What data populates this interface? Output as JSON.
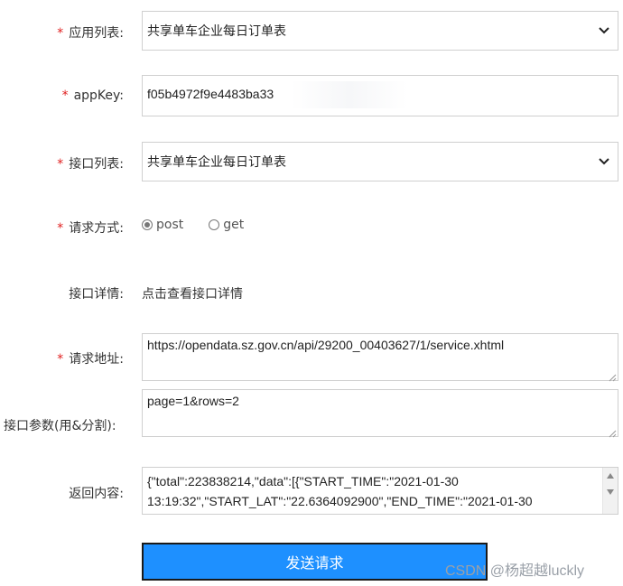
{
  "form": {
    "app_list": {
      "label": "应用列表:",
      "value": "共享单车企业每日订单表",
      "required": true
    },
    "app_key": {
      "label": "appKey:",
      "value": "f05b4972f9e4483ba33",
      "required": true
    },
    "api_list": {
      "label": "接口列表:",
      "value": "共享单车企业每日订单表",
      "required": true
    },
    "method": {
      "label": "请求方式:",
      "required": true,
      "options": [
        "post",
        "get"
      ],
      "selected": "post"
    },
    "api_detail": {
      "label": "接口详情:",
      "link": "点击查看接口详情"
    },
    "url": {
      "label": "请求地址:",
      "value": "https://opendata.sz.gov.cn/api/29200_00403627/1/service.xhtml",
      "required": true
    },
    "params": {
      "label": "接口参数(用&分割):",
      "value": "page=1&rows=2"
    },
    "response": {
      "label": "返回内容:",
      "value": "{\"total\":223838214,\"data\":[{\"START_TIME\":\"2021-01-30 13:19:32\",\"START_LAT\":\"22.6364092900\",\"END_TIME\":\"2021-01-30"
    },
    "send_button": "发送请求"
  },
  "required_mark": "*",
  "watermark": "CSDN @杨超越luckly",
  "colors": {
    "accent": "#1e90ff",
    "required": "#e02020"
  },
  "icons": {
    "select": "chevron-down-icon",
    "resize": "resize-grip-icon"
  }
}
